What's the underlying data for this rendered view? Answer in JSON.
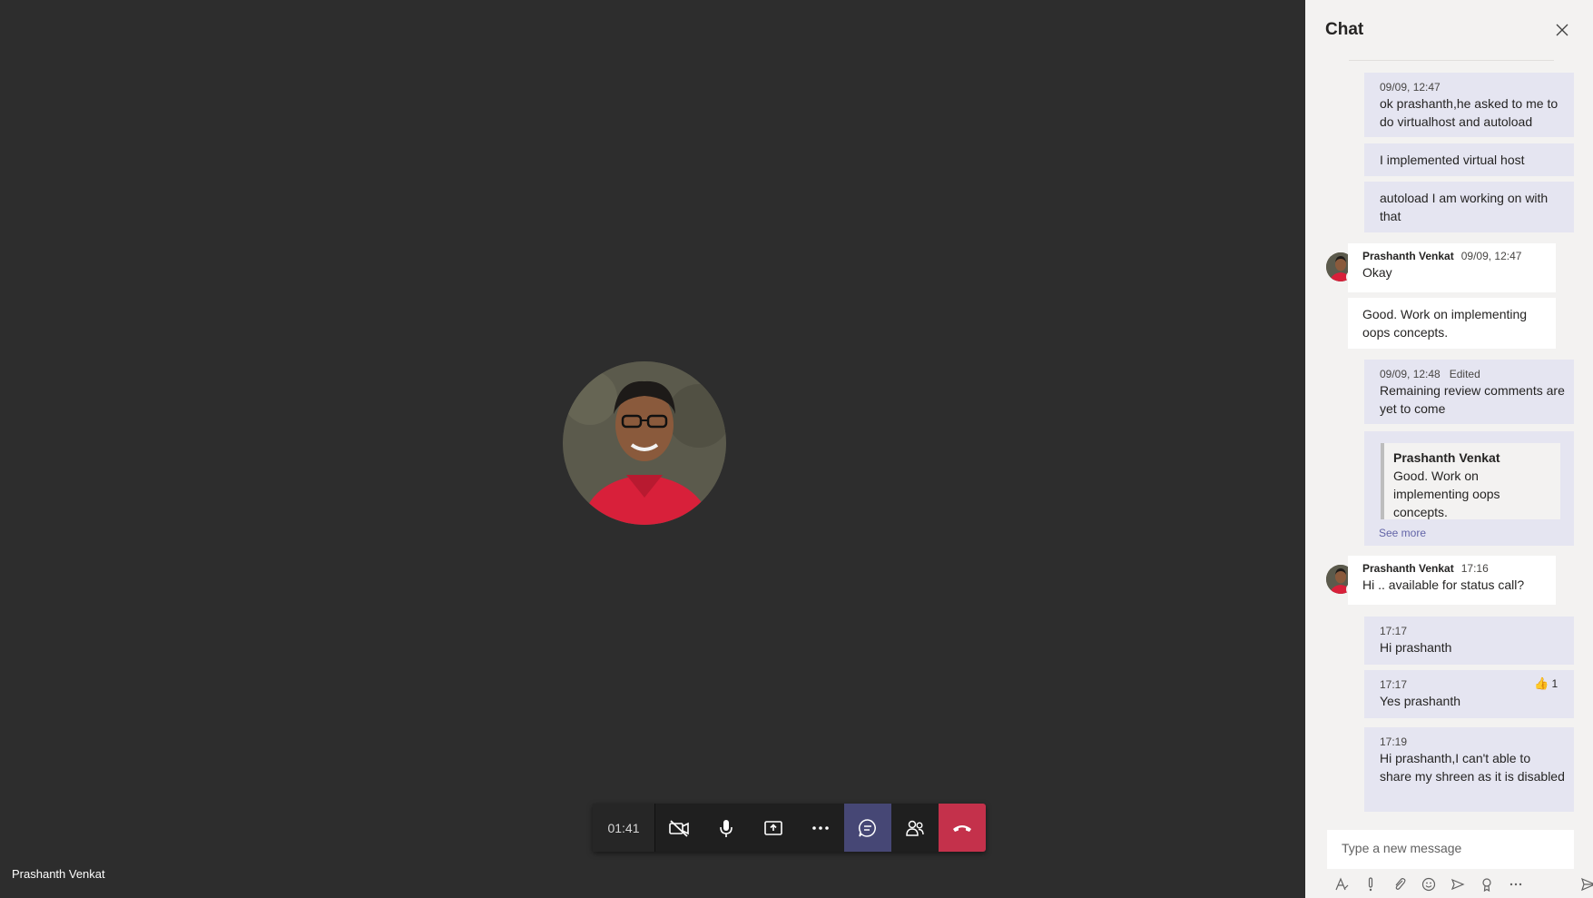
{
  "call": {
    "caller_name": "Prashanth Venkat",
    "timer": "01:41",
    "controls": [
      "camera-off-icon",
      "microphone-icon",
      "share-screen-icon",
      "more-options-icon",
      "chat-icon",
      "participants-icon",
      "hang-up-icon"
    ]
  },
  "chat": {
    "title": "Chat",
    "messages": [
      {
        "meta": "09/09, 12:47",
        "text": "ok prashanth,he asked to me to do virtualhost and autoload"
      },
      {
        "text": "I implemented virtual host"
      },
      {
        "text": "autoload I am working on with that"
      },
      {
        "sender": "Prashanth Venkat",
        "time": "09/09, 12:47",
        "text": "Okay"
      },
      {
        "text": "Good. Work on implementing oops concepts."
      },
      {
        "meta": "09/09, 12:48",
        "edited": "Edited",
        "text": "Remaining review comments are yet to come"
      },
      {
        "quote_sender": "Prashanth Venkat",
        "quote_text": "Good. Work on implementing oops concepts.",
        "see_more": "See more"
      },
      {
        "sender": "Prashanth Venkat",
        "time": "17:16",
        "text": "Hi .. available for status call?"
      },
      {
        "meta": "17:17",
        "text": "Hi prashanth"
      },
      {
        "meta": "17:17",
        "text": "Yes prashanth",
        "reaction_count": "1"
      },
      {
        "meta": "17:19",
        "text": "Hi prashanth,I can't able to share my shreen as it is disabled"
      }
    ],
    "compose_placeholder": "Type a new message",
    "toolbar": [
      "format-icon",
      "important-icon",
      "attach-icon",
      "emoji-icon",
      "giphy-icon",
      "praise-icon",
      "more-icon"
    ],
    "colors": {
      "accent": "#6264a7",
      "hangup": "#c4314b",
      "mine_bubble": "#e5e5f1"
    }
  }
}
